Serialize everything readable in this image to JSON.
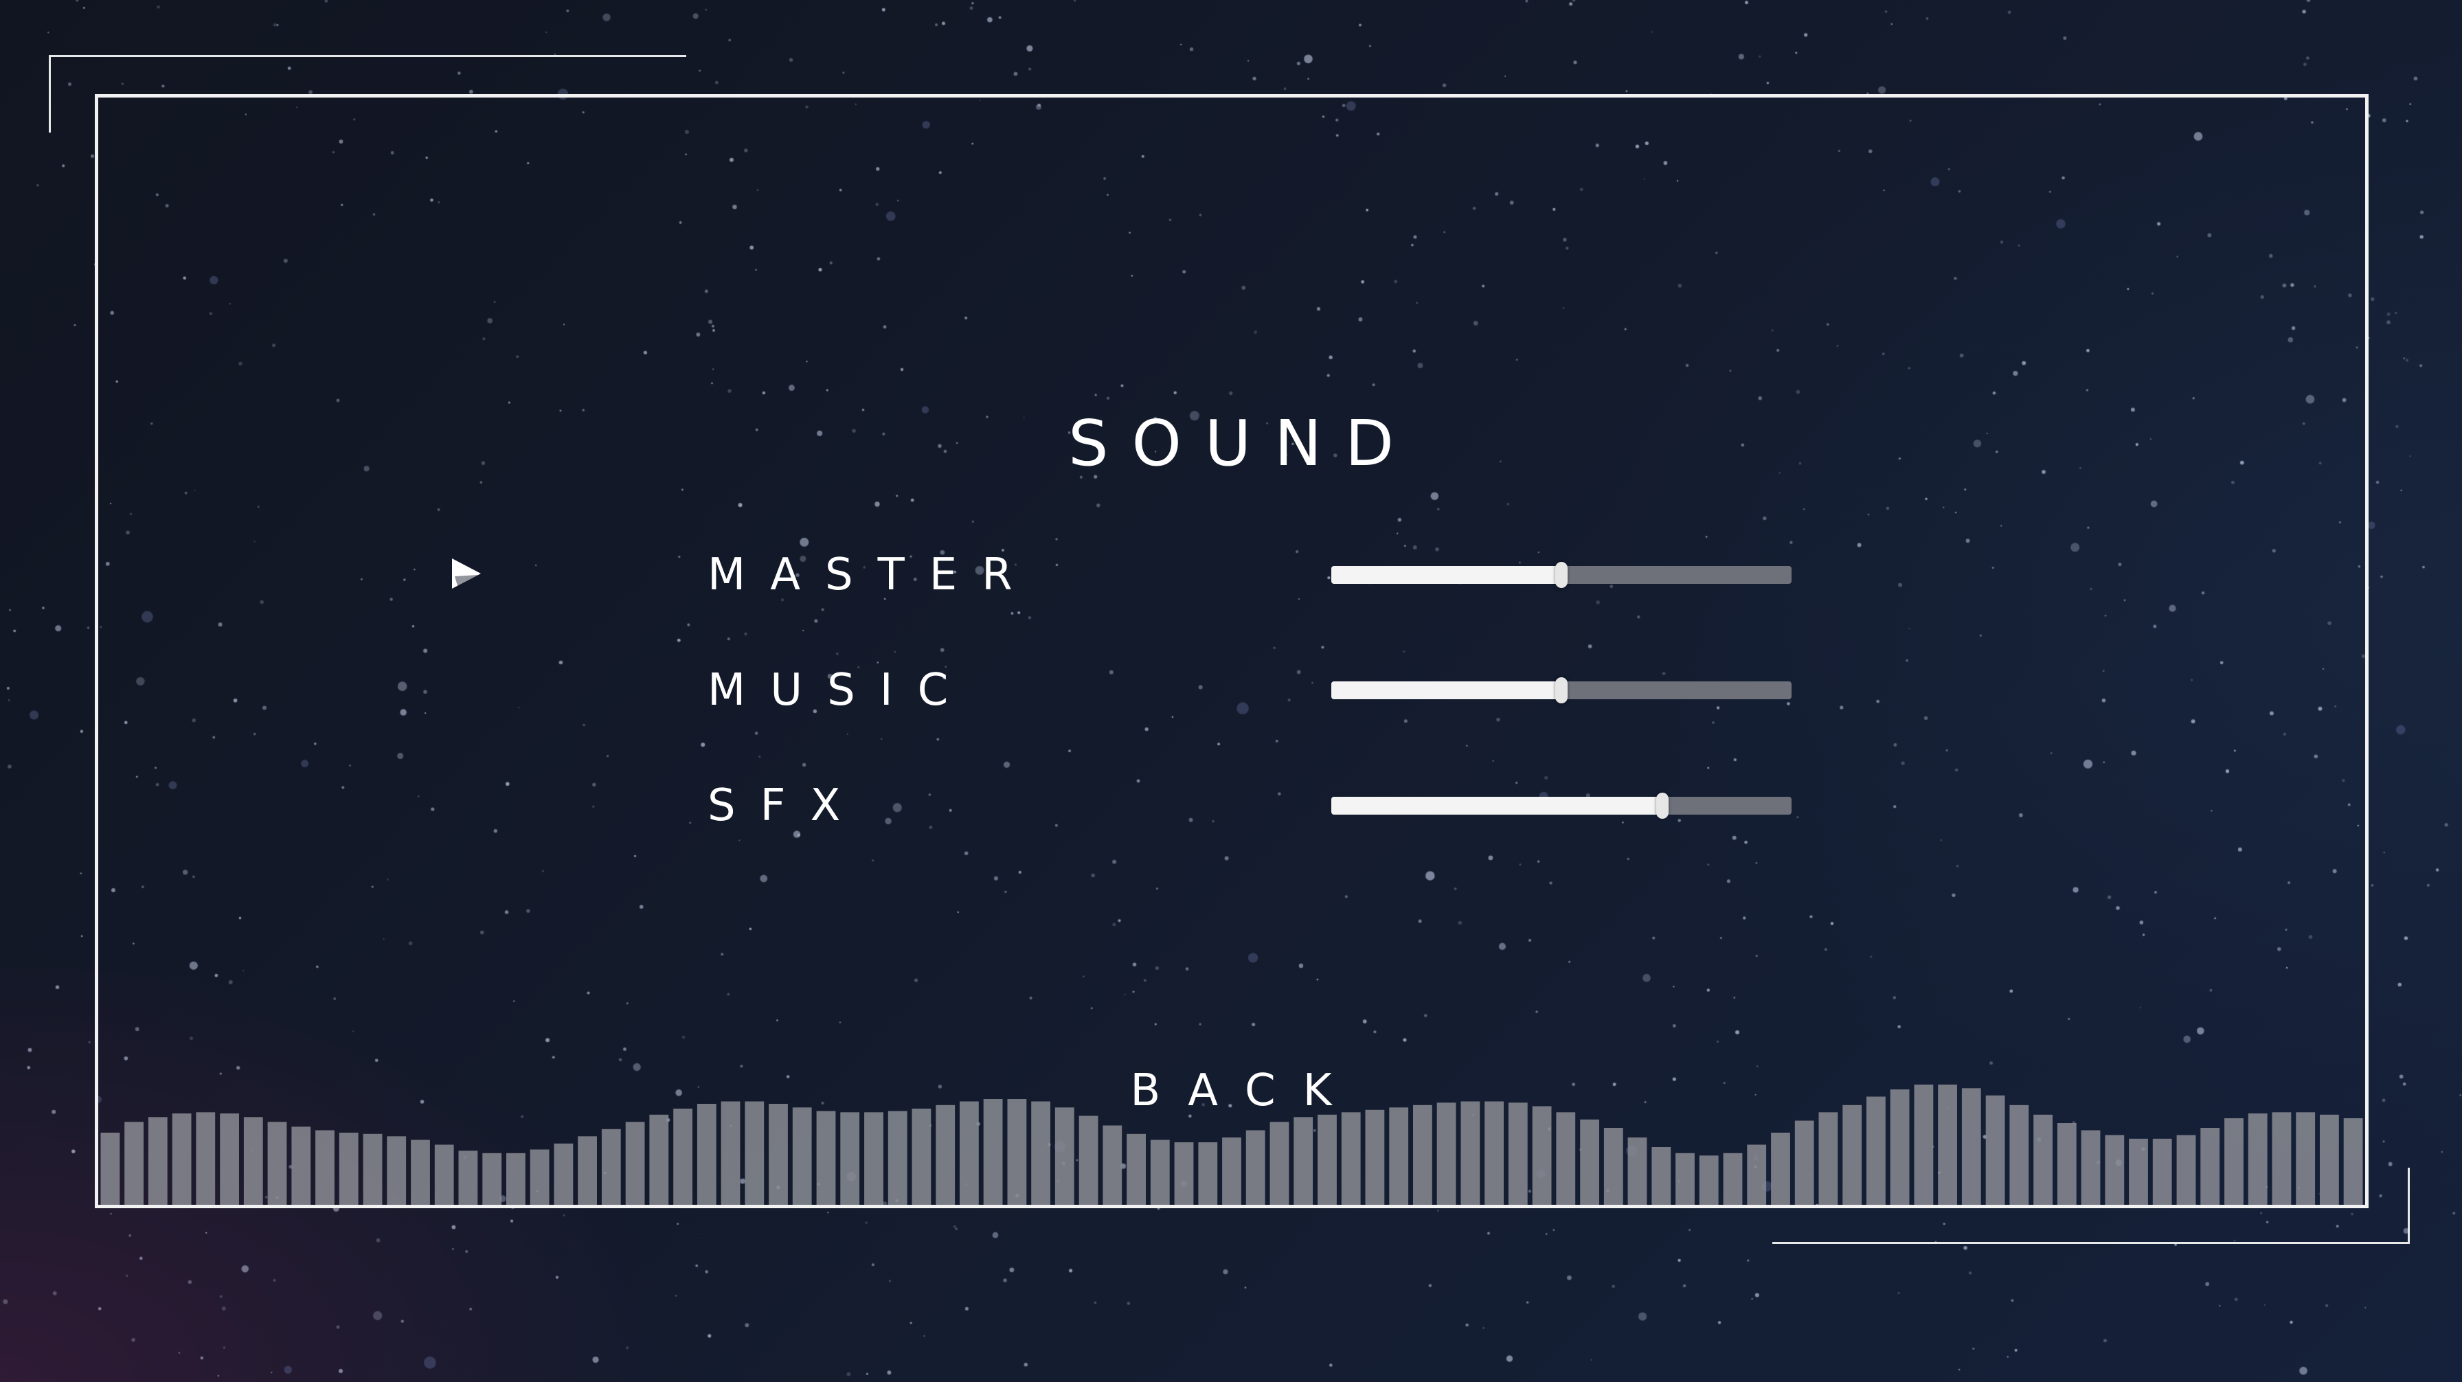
{
  "menu": {
    "title": "SOUND",
    "back_label": "BACK",
    "selected_index": 0
  },
  "settings": [
    {
      "id": "master",
      "label": "MASTER",
      "value": 0.5
    },
    {
      "id": "music",
      "label": "MUSIC",
      "value": 0.5
    },
    {
      "id": "sfx",
      "label": "SFX",
      "value": 0.72
    }
  ],
  "visualizer": {
    "levels": [
      0.6,
      0.69,
      0.73,
      0.76,
      0.77,
      0.76,
      0.73,
      0.69,
      0.65,
      0.62,
      0.6,
      0.59,
      0.57,
      0.54,
      0.5,
      0.45,
      0.43,
      0.43,
      0.46,
      0.51,
      0.57,
      0.63,
      0.69,
      0.75,
      0.8,
      0.84,
      0.86,
      0.86,
      0.84,
      0.81,
      0.78,
      0.77,
      0.77,
      0.78,
      0.8,
      0.83,
      0.86,
      0.88,
      0.88,
      0.86,
      0.81,
      0.74,
      0.66,
      0.59,
      0.54,
      0.52,
      0.52,
      0.56,
      0.62,
      0.69,
      0.73,
      0.75,
      0.77,
      0.79,
      0.81,
      0.83,
      0.85,
      0.86,
      0.86,
      0.85,
      0.82,
      0.77,
      0.71,
      0.64,
      0.56,
      0.48,
      0.43,
      0.41,
      0.43,
      0.5,
      0.6,
      0.7,
      0.77,
      0.83,
      0.9,
      0.96,
      1.0,
      1.0,
      0.97,
      0.91,
      0.83,
      0.75,
      0.68,
      0.62,
      0.58,
      0.55,
      0.55,
      0.58,
      0.64,
      0.72,
      0.76,
      0.77,
      0.77,
      0.75,
      0.72
    ],
    "bar_color": "#8a8c93",
    "bar_opacity": 0.85
  },
  "theme": {
    "text_color": "#ffffff",
    "frame_color": "#f2f2f2",
    "track_color": "#6e717a",
    "fill_color": "#f4f4f4"
  },
  "icons": {
    "selector": "play-arrow-icon"
  }
}
